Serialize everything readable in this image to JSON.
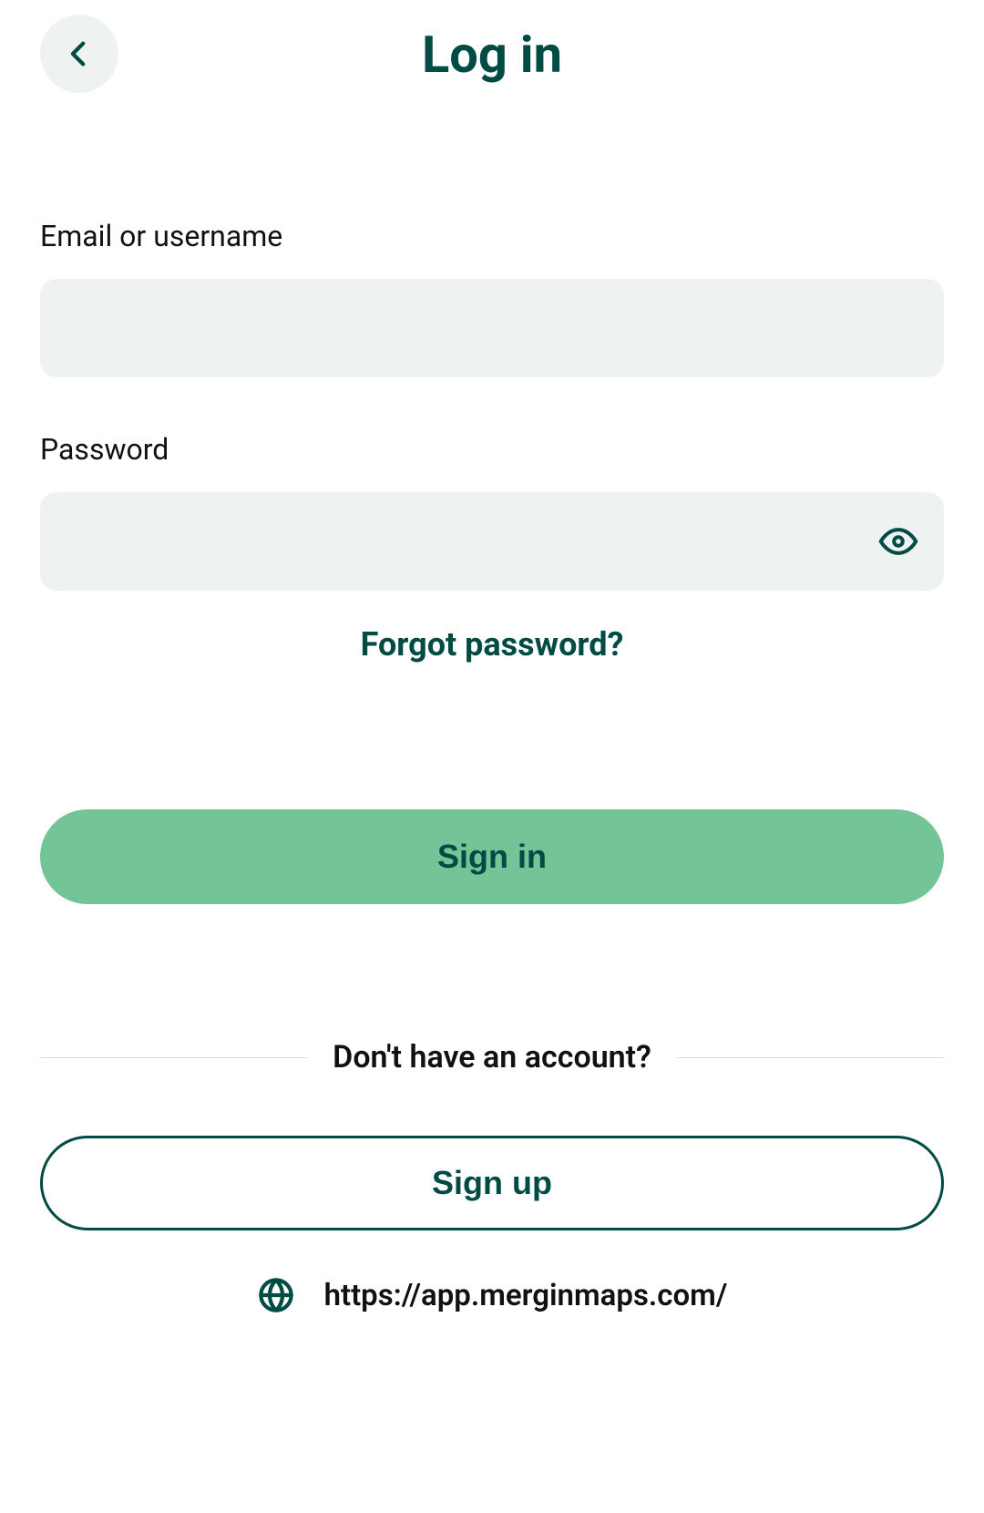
{
  "header": {
    "title": "Log in"
  },
  "form": {
    "email_label": "Email or username",
    "email_value": "",
    "email_placeholder": "",
    "password_label": "Password",
    "password_value": "",
    "password_placeholder": "",
    "forgot_label": "Forgot password?",
    "signin_label": "Sign in"
  },
  "signup": {
    "divider_text": "Don't have an account?",
    "signup_label": "Sign up"
  },
  "server": {
    "url": "https://app.merginmaps.com/"
  },
  "colors": {
    "brand_dark": "#004c45",
    "accent_green": "#73c496",
    "input_bg": "#eef2f1"
  }
}
